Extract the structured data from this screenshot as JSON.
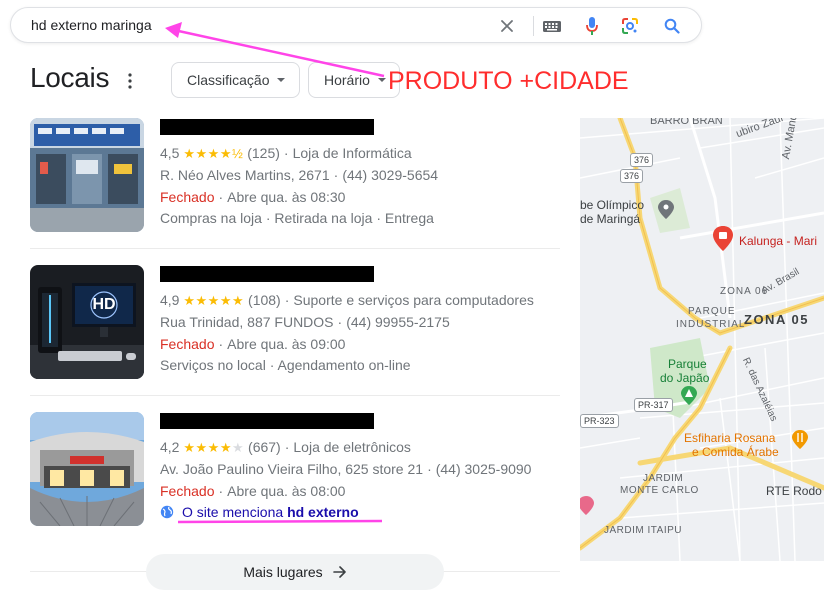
{
  "search": {
    "query": "hd externo maringa"
  },
  "header": {
    "title": "Locais",
    "chips": [
      "Classificação",
      "Horário"
    ]
  },
  "annotation": {
    "text": "PRODUTO +CIDADE",
    "color": "#ff2d2d",
    "arrow_color": "#ff44e8"
  },
  "listings": [
    {
      "rating": "4,5",
      "stars": "★★★★½",
      "reviews": "(125)",
      "category": "Loja de Informática",
      "address": "R. Néo Alves Martins, 2671",
      "phone": "(44) 3029-5654",
      "status": "Fechado",
      "hours": "Abre qua. às 08:30",
      "services": "Compras na loja · Retirada na loja · Entrega"
    },
    {
      "rating": "4,9",
      "stars": "★★★★★",
      "reviews": "(108)",
      "category": "Suporte e serviços para computadores",
      "address": "Rua Trinidad, 887 FUNDOS",
      "phone": "(44) 99955-2175",
      "status": "Fechado",
      "hours": "Abre qua. às 09:00",
      "services": "Serviços no local · Agendamento on-line"
    },
    {
      "rating": "4,2",
      "stars": "★★★★",
      "reviews": "(667)",
      "category": "Loja de eletrônicos",
      "address": "Av. João Paulino Vieira Filho, 625 store 21",
      "phone": "(44) 3025-9090",
      "status": "Fechado",
      "hours": "Abre qua. às 08:00",
      "site_prefix": "O site menciona",
      "site_term": "hd externo"
    }
  ],
  "more_button": "Mais lugares",
  "map": {
    "labels": {
      "barro_branco": "BARRO BRAN",
      "zurro": "ubiro Zaur",
      "mandacaru": "Av. Mandacaru",
      "estadio": "be Olímpico",
      "estadio2": "de Maringá",
      "kalunga": "Kalunga - Mari",
      "zona06": "ZONA 06",
      "av_brasil": "Av. Brasil",
      "parque_industrial": "PARQUE",
      "parque_industrial2": "INDUSTRIAL",
      "zona05": "ZONA 05",
      "parque_japao": "Parque",
      "parque_japao2": "do Japão",
      "azaleias": "R. das Azaléias",
      "esfiharia": "Esfiharia Rosana",
      "esfiharia2": "e Comida Árabe",
      "monte_carlo": "JARDIM",
      "monte_carlo2": "MONTE CARLO",
      "rte_rodo": "RTE Rodo",
      "itaipu": "JARDIM ITAIPU",
      "r376a": "376",
      "r376b": "376",
      "pr317": "PR-317",
      "pr323": "PR-323"
    }
  }
}
